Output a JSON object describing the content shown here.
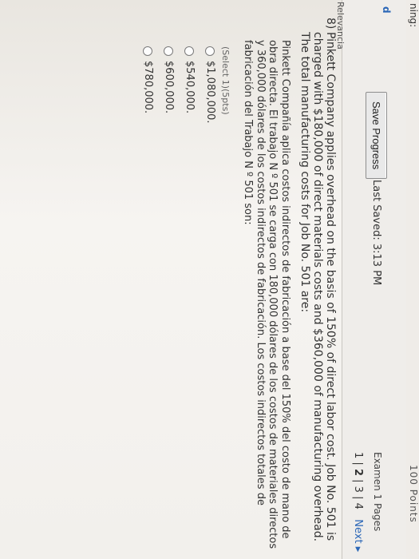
{
  "left_edge": {
    "cut_label_1": "ning:",
    "cut_label_2": "d",
    "cut_label_3": "Relevancia"
  },
  "header": {
    "save_label": "Save Progress",
    "last_saved": "Last Saved: 3:13 PM",
    "exam_pages_label": "Examen 1 Pages",
    "pages": [
      "1",
      "2",
      "3",
      "4"
    ],
    "current_page": "2",
    "next_label": "Next",
    "points": "100 Points"
  },
  "question": {
    "number": "8)",
    "text_en": "Pinkett Company applies overhead on the basis of 150% of direct labor cost. Job No. 501 is charged with $180,000 of direct materials costs and $360,000 of manufacturing overhead. The total manufacturing costs for Job No. 501 are:",
    "text_es": "Pinkett Compañía aplica costos indirectos de fabricación a base del 150% del costo de mano de obra directa. El trabajo N º 501 se carga con 180,000 dólares de los costos de materiales directos y 360,000 dólares de los costos indirectos de fabricación. Los costos indirectos totales de fabricación del Trabajo N º 501 son:",
    "select_hint": "(Select 1)(5pts)",
    "options": [
      "$1,080,000.",
      "$540,000.",
      "$600,000.",
      "$780,000."
    ]
  },
  "colors": {
    "link": "#2b67b7",
    "header_bg": "#efedea"
  }
}
